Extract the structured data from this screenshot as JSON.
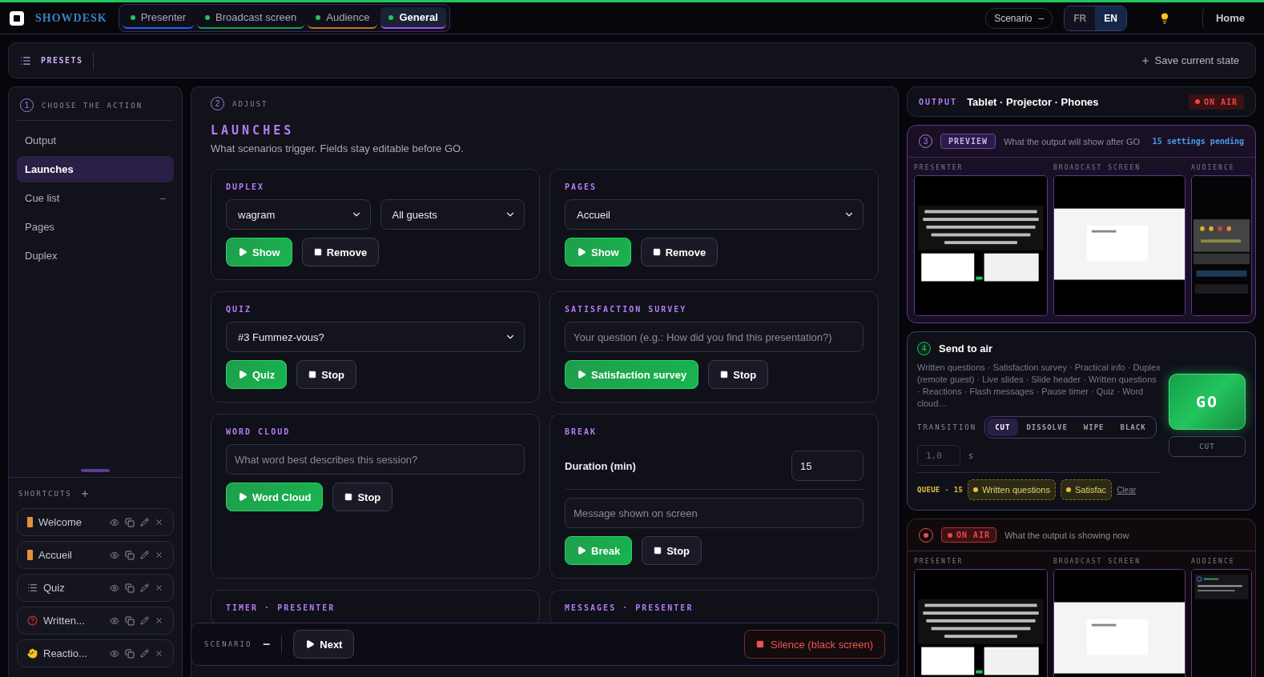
{
  "app": {
    "name": "SHOWDESK"
  },
  "tabs": [
    {
      "label": "Presenter",
      "selected": false,
      "color": "#2563eb",
      "online": true
    },
    {
      "label": "Broadcast screen",
      "selected": false,
      "color": "#16a34a",
      "online": true
    },
    {
      "label": "Audience",
      "selected": false,
      "color": "#c2791a",
      "online": true
    },
    {
      "label": "General",
      "selected": true,
      "color": "#a855f7",
      "online": true
    }
  ],
  "scenario_toggle": {
    "label": "Scenario",
    "symbol": "–"
  },
  "languages": [
    {
      "label": "FR",
      "selected": false
    },
    {
      "label": "EN",
      "selected": true
    }
  ],
  "home_button": "Home",
  "presets": {
    "title": "PRESETS",
    "save": "Save current state"
  },
  "sidebar": {
    "step": "1",
    "title": "CHOOSE THE ACTION",
    "items": [
      {
        "label": "Output",
        "selected": false
      },
      {
        "label": "Launches",
        "selected": true
      },
      {
        "label": "Cue list",
        "selected": false,
        "badge": "–"
      },
      {
        "label": "Pages",
        "selected": false
      },
      {
        "label": "Duplex",
        "selected": false
      }
    ],
    "shortcuts_title": "SHORTCUTS",
    "shortcuts": [
      {
        "label": "Welcome",
        "kind": "door"
      },
      {
        "label": "Accueil",
        "kind": "door"
      },
      {
        "label": "Quiz",
        "kind": "list"
      },
      {
        "label": "Written...",
        "kind": "question"
      },
      {
        "label": "Reactio...",
        "kind": "hand"
      }
    ]
  },
  "adjust": {
    "step": "2",
    "label": "ADJUST",
    "title": "LAUNCHES",
    "subtitle": "What scenarios trigger. Fields stay editable before GO.",
    "cards": [
      {
        "title": "DUPLEX",
        "items": [
          {
            "kind": "selects",
            "fields": [
              "wagram",
              "All guests"
            ]
          },
          {
            "kind": "buttons",
            "buttons": [
              {
                "label": "Show",
                "primary": true
              },
              {
                "label": "Remove",
                "primary": false
              }
            ]
          }
        ]
      },
      {
        "title": "PAGES",
        "items": [
          {
            "kind": "selects",
            "fields": [
              "Accueil"
            ]
          },
          {
            "kind": "buttons",
            "buttons": [
              {
                "label": "Show",
                "primary": true
              },
              {
                "label": "Remove",
                "primary": false
              }
            ]
          }
        ]
      },
      {
        "title": "QUIZ",
        "items": [
          {
            "kind": "selects",
            "fields": [
              "#3 Fummez-vous?"
            ]
          },
          {
            "kind": "buttons",
            "buttons": [
              {
                "label": "Quiz",
                "primary": true
              },
              {
                "label": "Stop",
                "primary": false
              }
            ]
          }
        ]
      },
      {
        "title": "SATISFACTION SURVEY",
        "items": [
          {
            "kind": "input",
            "placeholder": "Your question (e.g.: How did you find this presentation?)"
          },
          {
            "kind": "buttons",
            "buttons": [
              {
                "label": "Satisfaction survey",
                "primary": true
              },
              {
                "label": "Stop",
                "primary": false
              }
            ]
          }
        ]
      },
      {
        "title": "WORD CLOUD",
        "items": [
          {
            "kind": "input",
            "placeholder": "What word best describes this session?"
          },
          {
            "kind": "buttons",
            "buttons": [
              {
                "label": "Word Cloud",
                "primary": true
              },
              {
                "label": "Stop",
                "primary": false
              }
            ]
          }
        ]
      },
      {
        "title": "BREAK",
        "items": [
          {
            "kind": "number",
            "label": "Duration (min)",
            "value": "15"
          },
          {
            "kind": "input",
            "placeholder": "Message shown on screen"
          },
          {
            "kind": "buttons",
            "buttons": [
              {
                "label": "Break",
                "primary": true
              },
              {
                "label": "Stop",
                "primary": false
              }
            ]
          }
        ]
      },
      {
        "title": "TIMER · PRESENTER"
      },
      {
        "title": "MESSAGES · PRESENTER"
      }
    ]
  },
  "scenario_bar": {
    "label": "SCENARIO",
    "symbol": "–",
    "next": "Next",
    "silence": "Silence (black screen)"
  },
  "output": {
    "label": "OUTPUT",
    "devices": "Tablet · Projector · Phones",
    "status": "ON AIR"
  },
  "preview": {
    "step": "3",
    "badge": "PREVIEW",
    "caption": "What the output will show after GO",
    "pending": "15 settings pending",
    "screens": [
      {
        "label": "PRESENTER",
        "kind": "presenter"
      },
      {
        "label": "BROADCAST SCREEN",
        "kind": "broadcast"
      },
      {
        "label": "AUDIENCE",
        "kind": "audience"
      }
    ]
  },
  "send": {
    "step": "4",
    "title": "Send to air",
    "summary": "Written questions · Satisfaction survey · Practical info · Duplex (remote guest) · Live slides · Slide header · Written questions · Reactions · Flash messages · Pause timer · Quiz · Word cloud…",
    "transition_label": "TRANSITION",
    "transitions": [
      {
        "label": "CUT",
        "selected": true
      },
      {
        "label": "DISSOLVE",
        "selected": false
      },
      {
        "label": "WIPE",
        "selected": false
      },
      {
        "label": "BLACK",
        "selected": false
      }
    ],
    "duration": "1,0",
    "unit": "s",
    "go": "GO",
    "mode": "CUT",
    "queue_label": "QUEUE · 15",
    "queue": [
      "Written questions",
      "Satisfac"
    ],
    "clear": "Clear"
  },
  "on_air": {
    "badge": "ON AIR",
    "caption": "What the output is showing now",
    "screens": [
      {
        "label": "PRESENTER",
        "kind": "presenter"
      },
      {
        "label": "BROADCAST SCREEN",
        "kind": "broadcast"
      },
      {
        "label": "AUDIENCE",
        "kind": "audience-live"
      }
    ]
  }
}
